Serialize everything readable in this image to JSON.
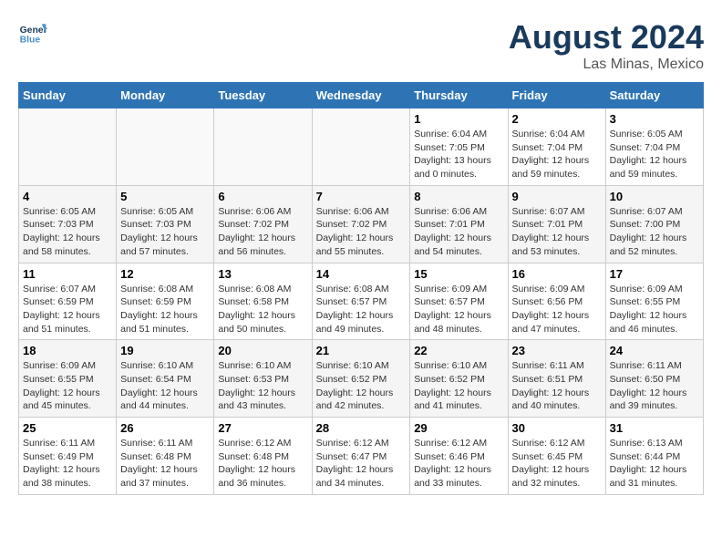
{
  "header": {
    "logo_line1": "General",
    "logo_line2": "Blue",
    "month_year": "August 2024",
    "location": "Las Minas, Mexico"
  },
  "days_of_week": [
    "Sunday",
    "Monday",
    "Tuesday",
    "Wednesday",
    "Thursday",
    "Friday",
    "Saturday"
  ],
  "weeks": [
    [
      {
        "num": "",
        "info": ""
      },
      {
        "num": "",
        "info": ""
      },
      {
        "num": "",
        "info": ""
      },
      {
        "num": "",
        "info": ""
      },
      {
        "num": "1",
        "info": "Sunrise: 6:04 AM\nSunset: 7:05 PM\nDaylight: 13 hours\nand 0 minutes."
      },
      {
        "num": "2",
        "info": "Sunrise: 6:04 AM\nSunset: 7:04 PM\nDaylight: 12 hours\nand 59 minutes."
      },
      {
        "num": "3",
        "info": "Sunrise: 6:05 AM\nSunset: 7:04 PM\nDaylight: 12 hours\nand 59 minutes."
      }
    ],
    [
      {
        "num": "4",
        "info": "Sunrise: 6:05 AM\nSunset: 7:03 PM\nDaylight: 12 hours\nand 58 minutes."
      },
      {
        "num": "5",
        "info": "Sunrise: 6:05 AM\nSunset: 7:03 PM\nDaylight: 12 hours\nand 57 minutes."
      },
      {
        "num": "6",
        "info": "Sunrise: 6:06 AM\nSunset: 7:02 PM\nDaylight: 12 hours\nand 56 minutes."
      },
      {
        "num": "7",
        "info": "Sunrise: 6:06 AM\nSunset: 7:02 PM\nDaylight: 12 hours\nand 55 minutes."
      },
      {
        "num": "8",
        "info": "Sunrise: 6:06 AM\nSunset: 7:01 PM\nDaylight: 12 hours\nand 54 minutes."
      },
      {
        "num": "9",
        "info": "Sunrise: 6:07 AM\nSunset: 7:01 PM\nDaylight: 12 hours\nand 53 minutes."
      },
      {
        "num": "10",
        "info": "Sunrise: 6:07 AM\nSunset: 7:00 PM\nDaylight: 12 hours\nand 52 minutes."
      }
    ],
    [
      {
        "num": "11",
        "info": "Sunrise: 6:07 AM\nSunset: 6:59 PM\nDaylight: 12 hours\nand 51 minutes."
      },
      {
        "num": "12",
        "info": "Sunrise: 6:08 AM\nSunset: 6:59 PM\nDaylight: 12 hours\nand 51 minutes."
      },
      {
        "num": "13",
        "info": "Sunrise: 6:08 AM\nSunset: 6:58 PM\nDaylight: 12 hours\nand 50 minutes."
      },
      {
        "num": "14",
        "info": "Sunrise: 6:08 AM\nSunset: 6:57 PM\nDaylight: 12 hours\nand 49 minutes."
      },
      {
        "num": "15",
        "info": "Sunrise: 6:09 AM\nSunset: 6:57 PM\nDaylight: 12 hours\nand 48 minutes."
      },
      {
        "num": "16",
        "info": "Sunrise: 6:09 AM\nSunset: 6:56 PM\nDaylight: 12 hours\nand 47 minutes."
      },
      {
        "num": "17",
        "info": "Sunrise: 6:09 AM\nSunset: 6:55 PM\nDaylight: 12 hours\nand 46 minutes."
      }
    ],
    [
      {
        "num": "18",
        "info": "Sunrise: 6:09 AM\nSunset: 6:55 PM\nDaylight: 12 hours\nand 45 minutes."
      },
      {
        "num": "19",
        "info": "Sunrise: 6:10 AM\nSunset: 6:54 PM\nDaylight: 12 hours\nand 44 minutes."
      },
      {
        "num": "20",
        "info": "Sunrise: 6:10 AM\nSunset: 6:53 PM\nDaylight: 12 hours\nand 43 minutes."
      },
      {
        "num": "21",
        "info": "Sunrise: 6:10 AM\nSunset: 6:52 PM\nDaylight: 12 hours\nand 42 minutes."
      },
      {
        "num": "22",
        "info": "Sunrise: 6:10 AM\nSunset: 6:52 PM\nDaylight: 12 hours\nand 41 minutes."
      },
      {
        "num": "23",
        "info": "Sunrise: 6:11 AM\nSunset: 6:51 PM\nDaylight: 12 hours\nand 40 minutes."
      },
      {
        "num": "24",
        "info": "Sunrise: 6:11 AM\nSunset: 6:50 PM\nDaylight: 12 hours\nand 39 minutes."
      }
    ],
    [
      {
        "num": "25",
        "info": "Sunrise: 6:11 AM\nSunset: 6:49 PM\nDaylight: 12 hours\nand 38 minutes."
      },
      {
        "num": "26",
        "info": "Sunrise: 6:11 AM\nSunset: 6:48 PM\nDaylight: 12 hours\nand 37 minutes."
      },
      {
        "num": "27",
        "info": "Sunrise: 6:12 AM\nSunset: 6:48 PM\nDaylight: 12 hours\nand 36 minutes."
      },
      {
        "num": "28",
        "info": "Sunrise: 6:12 AM\nSunset: 6:47 PM\nDaylight: 12 hours\nand 34 minutes."
      },
      {
        "num": "29",
        "info": "Sunrise: 6:12 AM\nSunset: 6:46 PM\nDaylight: 12 hours\nand 33 minutes."
      },
      {
        "num": "30",
        "info": "Sunrise: 6:12 AM\nSunset: 6:45 PM\nDaylight: 12 hours\nand 32 minutes."
      },
      {
        "num": "31",
        "info": "Sunrise: 6:13 AM\nSunset: 6:44 PM\nDaylight: 12 hours\nand 31 minutes."
      }
    ]
  ]
}
